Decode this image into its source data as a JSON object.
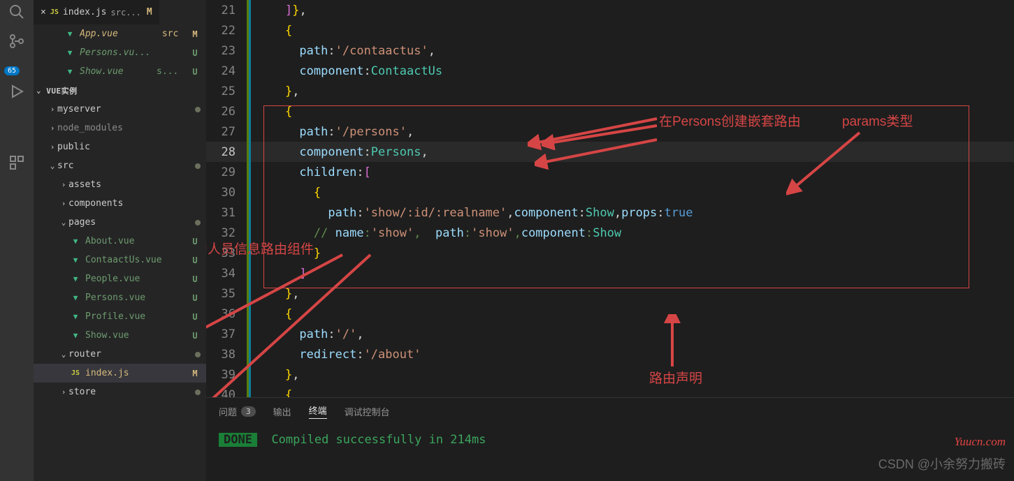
{
  "activity_badge": "65",
  "tabs": {
    "active": {
      "icon": "JS",
      "name": "index.js",
      "path": "src...",
      "status": "M"
    },
    "open": [
      {
        "icon": "V",
        "name": "App.vue",
        "path": "src",
        "status": "M",
        "class": "modified"
      },
      {
        "icon": "V",
        "name": "Persons.vu...",
        "path": "",
        "status": "U",
        "class": "untracked"
      },
      {
        "icon": "V",
        "name": "Show.vue",
        "path": "s...",
        "status": "U",
        "class": "untracked"
      }
    ]
  },
  "section_title": "VUE实例",
  "explorer": [
    {
      "indent": 1,
      "chev": "›",
      "label": "myserver",
      "status": "dot"
    },
    {
      "indent": 1,
      "chev": "›",
      "label": "node_modules",
      "status": "",
      "dim": true
    },
    {
      "indent": 1,
      "chev": "›",
      "label": "public",
      "status": ""
    },
    {
      "indent": 1,
      "chev": "⌄",
      "label": "src",
      "status": "dot"
    },
    {
      "indent": 2,
      "chev": "›",
      "label": "assets",
      "status": ""
    },
    {
      "indent": 2,
      "chev": "›",
      "label": "components",
      "status": ""
    },
    {
      "indent": 2,
      "chev": "⌄",
      "label": "pages",
      "status": "dot"
    },
    {
      "indent": 3,
      "icon": "V",
      "label": "About.vue",
      "status": "U",
      "class": "untracked"
    },
    {
      "indent": 3,
      "icon": "V",
      "label": "ContaactUs.vue",
      "status": "U",
      "class": "untracked"
    },
    {
      "indent": 3,
      "icon": "V",
      "label": "People.vue",
      "status": "U",
      "class": "untracked"
    },
    {
      "indent": 3,
      "icon": "V",
      "label": "Persons.vue",
      "status": "U",
      "class": "untracked"
    },
    {
      "indent": 3,
      "icon": "V",
      "label": "Profile.vue",
      "status": "U",
      "class": "untracked"
    },
    {
      "indent": 3,
      "icon": "V",
      "label": "Show.vue",
      "status": "U",
      "class": "untracked"
    },
    {
      "indent": 2,
      "chev": "⌄",
      "label": "router",
      "status": "dot"
    },
    {
      "indent": 3,
      "icon": "JS",
      "label": "index.js",
      "status": "M",
      "class": "modified",
      "active": true
    },
    {
      "indent": 2,
      "chev": "›",
      "label": "store",
      "status": "dot"
    }
  ],
  "code": {
    "start": 21,
    "lines": [
      "    ]},",
      "    {",
      "      path:'/contaactus',",
      "      component:ContaactUs",
      "    },",
      "    {",
      "      path:'/persons',",
      "      component:Persons,",
      "      children:[",
      "        {",
      "          path:'show/:id/:realname',component:Show,props:true",
      "        // name:'show',  path:'show',component:Show",
      "        }",
      "      ]",
      "    },",
      "    {",
      "      path:'/',",
      "      redirect:'/about'",
      "    },",
      "    {"
    ]
  },
  "annotations": {
    "a1": "在Persons创建嵌套路由",
    "a2": "params类型",
    "a3": "视频中人员信息路由组件",
    "a4": "路由声明"
  },
  "terminal": {
    "tabs": {
      "problems": "问题",
      "problems_count": "3",
      "output": "输出",
      "term": "终端",
      "debug": "调试控制台"
    },
    "done": "DONE",
    "msg": "Compiled successfully in 214ms"
  },
  "watermark1": "Yuucn.com",
  "watermark2": "CSDN @小余努力搬砖"
}
